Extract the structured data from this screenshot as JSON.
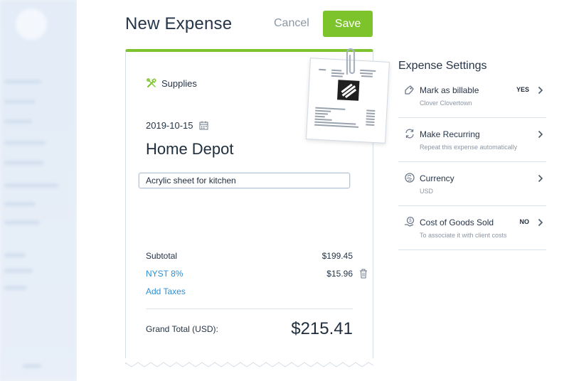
{
  "header": {
    "title": "New Expense",
    "cancel_label": "Cancel",
    "save_label": "Save"
  },
  "expense": {
    "category": "Supplies",
    "date": "2019-10-15",
    "merchant": "Home Depot",
    "description": "Acrylic sheet for kitchen",
    "subtotal_label": "Subtotal",
    "subtotal_value": "$199.45",
    "tax_name": "NYST 8%",
    "tax_value": "$15.96",
    "add_taxes_label": "Add Taxes",
    "grand_total_label": "Grand Total (USD):",
    "grand_total_value": "$215.41"
  },
  "settings": {
    "title": "Expense Settings",
    "items": [
      {
        "title": "Mark as billable",
        "subtitle": "Clover Clovertown",
        "badge": "YES",
        "icon": "billable-icon"
      },
      {
        "title": "Make Recurring",
        "subtitle": "Repeat this expense automatically",
        "badge": "",
        "icon": "recurring-icon"
      },
      {
        "title": "Currency",
        "subtitle": "USD",
        "badge": "",
        "icon": "currency-icon"
      },
      {
        "title": "Cost of Goods Sold",
        "subtitle": "To associate it with client costs",
        "badge": "NO",
        "icon": "cogs-icon"
      }
    ]
  },
  "colors": {
    "accent_green": "#7dc42c",
    "link_blue": "#2f8fd3",
    "text_dark": "#1f2d3d",
    "text_muted": "#8b97a5"
  }
}
